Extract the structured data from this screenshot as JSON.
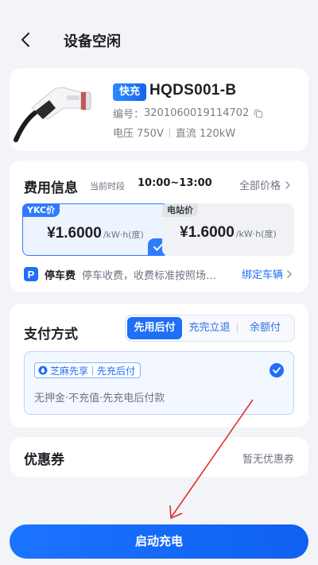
{
  "header": {
    "title": "设备空闲"
  },
  "device": {
    "badge": "快充",
    "id": "HQDS001-B",
    "serial_label": "编号：",
    "serial": "3201060019114702",
    "voltage": "电压 750V",
    "current_type": "直流 120kW"
  },
  "fee": {
    "title": "费用信息",
    "period_label": "当前时段",
    "period_value": "10:00~13:00",
    "all_price": "全部价格",
    "ykc": {
      "tag": "YKC价",
      "price": "¥1.6000",
      "unit": "/kW·h(度)"
    },
    "station": {
      "tag": "电站价",
      "price": "¥1.6000",
      "unit": "/kW·h(度)"
    },
    "parking": {
      "icon_letter": "P",
      "label": "停车费",
      "desc": "停车收费，收费标准按照场…",
      "bind_car": "绑定车辆"
    }
  },
  "payment": {
    "title": "支付方式",
    "tabs": [
      "先用后付",
      "充完立退",
      "余额付"
    ],
    "option": {
      "badge_left": "芝麻先享",
      "badge_right": "先充后付",
      "desc": "无押金·不充值·先充电后付款"
    }
  },
  "coupon": {
    "title": "优惠券",
    "value": "暂无优惠券"
  },
  "action": {
    "start_label": "启动充电"
  },
  "colors": {
    "accent": "#1f6ff7",
    "annotation": "#e0302a"
  }
}
